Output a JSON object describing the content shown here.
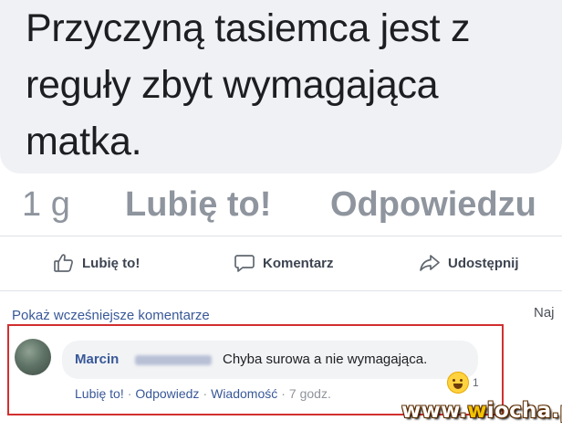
{
  "post": {
    "text_lines": [
      "Przyczyną tasiemca jest z",
      "reguły zbyt wymagająca",
      "matka."
    ],
    "meta": {
      "time": "1 g",
      "like": "Lubię to!",
      "reply": "Odpowiedzu"
    }
  },
  "actions": {
    "like": {
      "label": "Lubię to!",
      "icon": "thumbs-up-icon"
    },
    "comment": {
      "label": "Komentarz",
      "icon": "speech-bubble-icon"
    },
    "share": {
      "label": "Udostępnij",
      "icon": "share-arrow-icon"
    }
  },
  "comments": {
    "show_more": "Pokaż wcześniejsze komentarze",
    "right_cut": "Naj"
  },
  "comment": {
    "author": "Marcin",
    "text": "Chyba surowa a nie wymagająca.",
    "reaction": {
      "icon": "laughing-emoji-icon",
      "count": "1"
    },
    "links": {
      "like": "Lubię to!",
      "reply": "Odpowiedz",
      "message": "Wiadomość",
      "time": "7 godz."
    }
  },
  "watermark": {
    "prefix": "www.",
    "accent": "w",
    "rest": "iocha.pl"
  },
  "colors": {
    "link": "#385898",
    "highlight": "#d22f2f",
    "bubble": "#f2f3f5"
  }
}
